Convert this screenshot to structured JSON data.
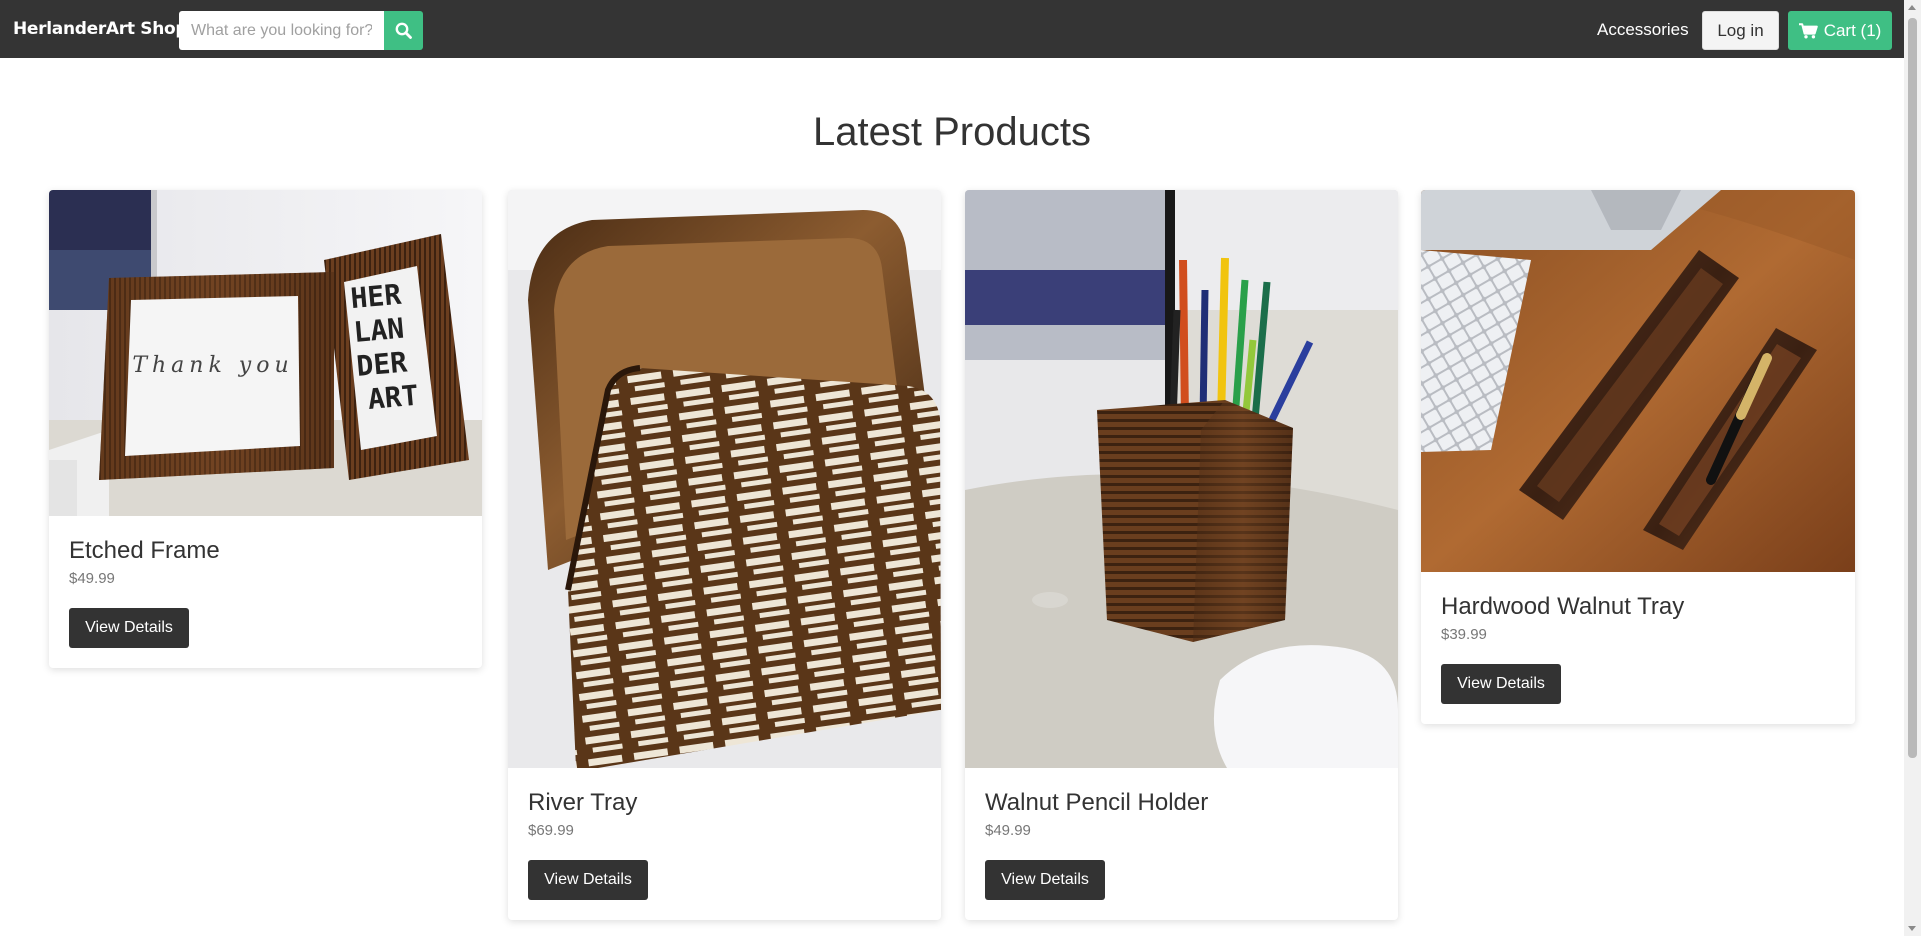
{
  "navbar": {
    "brand": "HerlanderArt Shop",
    "search_placeholder": "What are you looking for?",
    "accessories_label": "Accessories",
    "login_label": "Log in",
    "cart_label": "Cart (1)",
    "accent_color": "#3fbf84",
    "bg_color": "#343434"
  },
  "main": {
    "title": "Latest Products",
    "products": [
      {
        "name": "Etched Frame",
        "price": "$49.99",
        "button": "View Details",
        "image_text_left": "Thank you",
        "image_text_right": [
          "HER",
          "LAN",
          "DER",
          "ART"
        ]
      },
      {
        "name": "River Tray",
        "price": "$69.99",
        "button": "View Details"
      },
      {
        "name": "Walnut Pencil Holder",
        "price": "$49.99",
        "button": "View Details"
      },
      {
        "name": "Hardwood Walnut Tray",
        "price": "$39.99",
        "button": "View Details"
      }
    ]
  },
  "icons": {
    "search": "search-icon",
    "cart": "cart-icon"
  }
}
